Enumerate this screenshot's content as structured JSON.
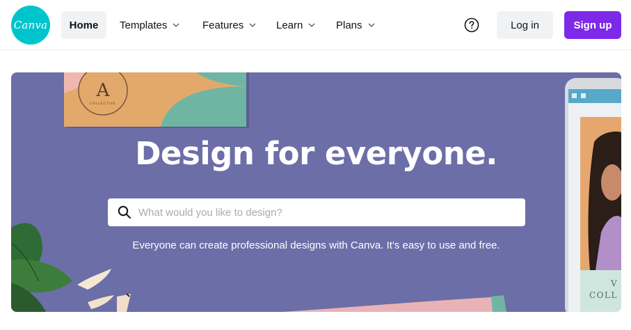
{
  "header": {
    "logo_text": "Canva",
    "nav": {
      "home": "Home",
      "templates": "Templates",
      "features": "Features",
      "learn": "Learn",
      "plans": "Plans"
    },
    "help_icon": "question-circle-icon",
    "login_label": "Log in",
    "signup_label": "Sign up"
  },
  "hero": {
    "title": "Design for everyone.",
    "search_placeholder": "What would you like to design?",
    "subtitle": "Everyone can create professional designs with Canva. It's easy to use and free.",
    "card_monogram": "A",
    "card_subtext": "COLLECTIVE",
    "phone_text_1": "V",
    "phone_text_2": "COLL"
  },
  "colors": {
    "brand": "#00c4cc",
    "signup": "#7d2ae8",
    "hero_bg": "#6c6ea8"
  }
}
